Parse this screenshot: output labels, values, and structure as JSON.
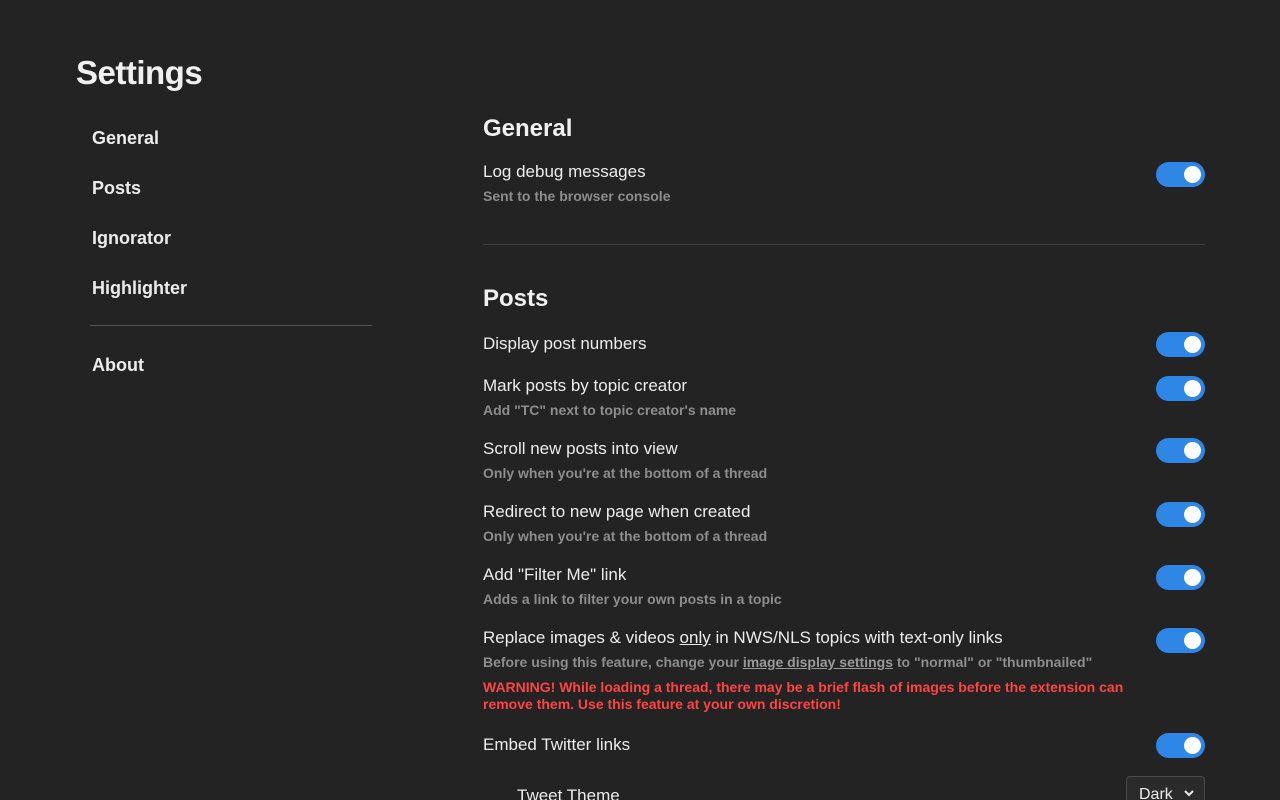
{
  "page": {
    "title": "Settings"
  },
  "sidebar": {
    "items": [
      {
        "label": "General"
      },
      {
        "label": "Posts"
      },
      {
        "label": "Ignorator"
      },
      {
        "label": "Highlighter"
      }
    ],
    "about_label": "About"
  },
  "general": {
    "title": "General",
    "log_debug": {
      "label": "Log debug messages",
      "desc": "Sent to the browser console",
      "enabled": true
    }
  },
  "posts": {
    "title": "Posts",
    "display_numbers": {
      "label": "Display post numbers",
      "enabled": true
    },
    "mark_tc": {
      "label": "Mark posts by topic creator",
      "desc": "Add \"TC\" next to topic creator's name",
      "enabled": true
    },
    "scroll_new": {
      "label": "Scroll new posts into view",
      "desc": "Only when you're at the bottom of a thread",
      "enabled": true
    },
    "redirect_new": {
      "label": "Redirect to new page when created",
      "desc": "Only when you're at the bottom of a thread",
      "enabled": true
    },
    "filter_me": {
      "label": "Add \"Filter Me\" link",
      "desc": "Adds a link to filter your own posts in a topic",
      "enabled": true
    },
    "replace_media": {
      "label_before": "Replace images & videos ",
      "label_underlined": "only",
      "label_after": " in NWS/NLS topics with text-only links",
      "desc_before": "Before using this feature, change your ",
      "desc_link": "image display settings",
      "desc_after": " to \"normal\" or \"thumbnailed\"",
      "warning": "WARNING! While loading a thread, there may be a brief flash of images before the extension can remove them. Use this feature at your own discretion!",
      "enabled": true
    },
    "embed_twitter": {
      "label": "Embed Twitter links",
      "enabled": true
    },
    "tweet_theme": {
      "label": "Tweet Theme",
      "value": "Dark"
    }
  },
  "colors": {
    "accent": "#2e86e6",
    "warning": "#ff4444",
    "background": "#232323"
  }
}
